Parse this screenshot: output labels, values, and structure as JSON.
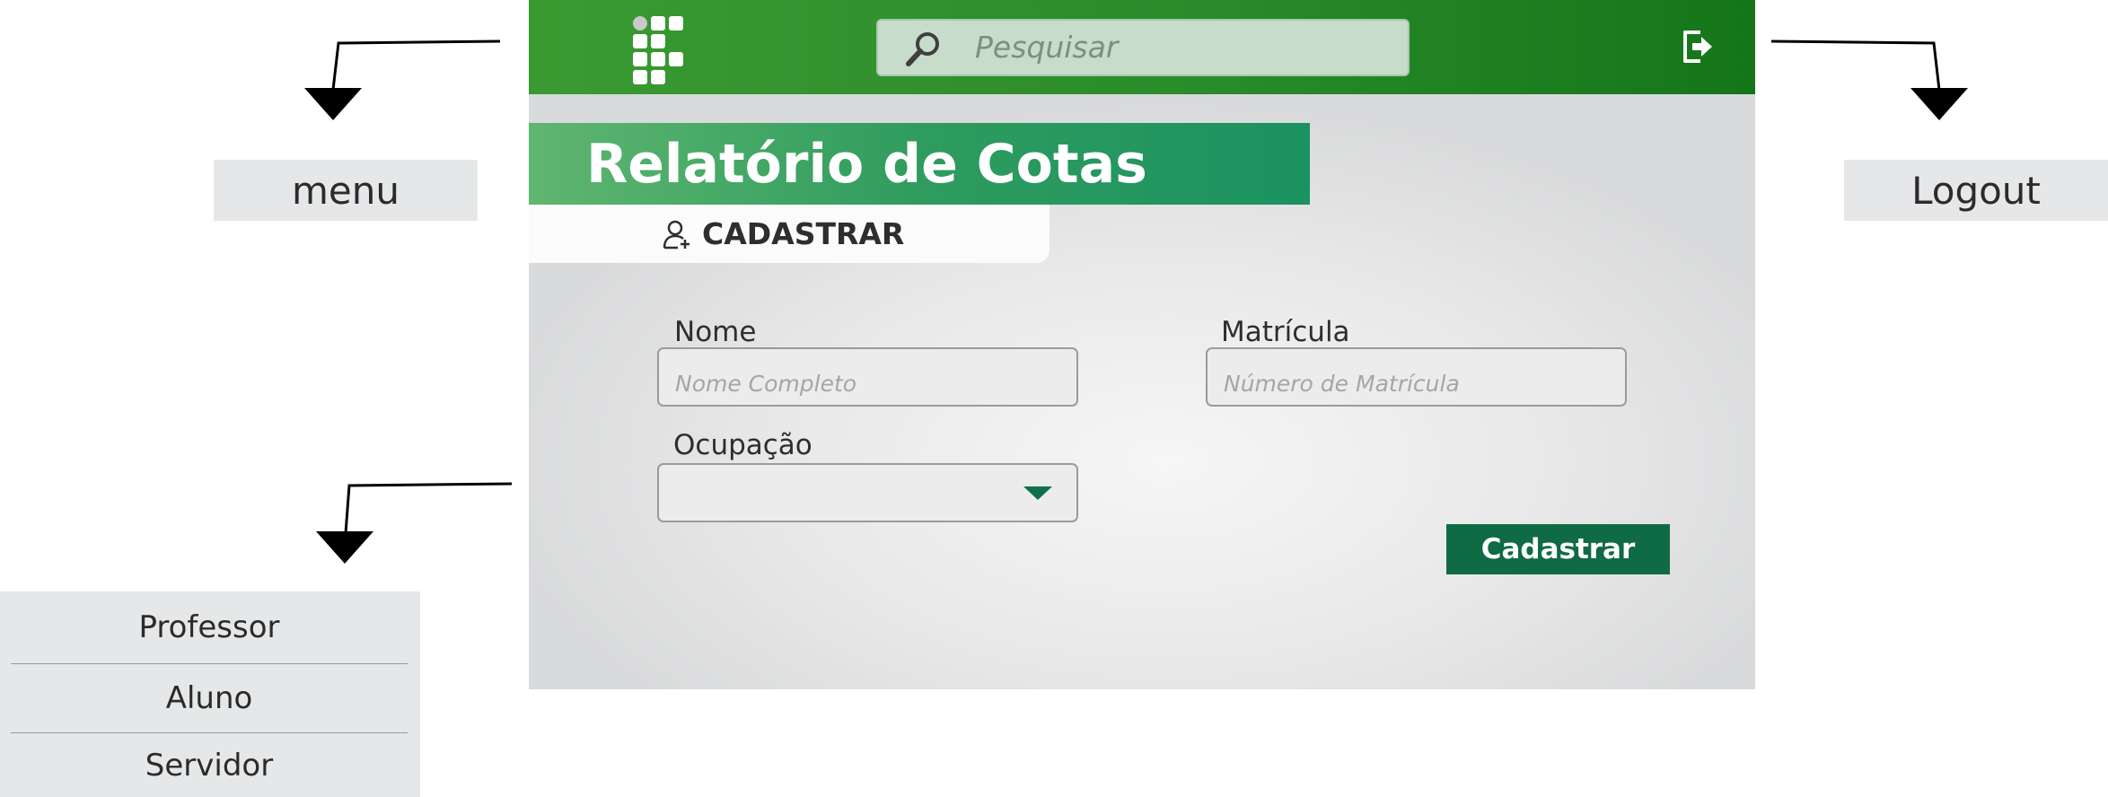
{
  "annotations": {
    "menu_label": "menu",
    "logout_label": "Logout",
    "occupation_options": [
      "Professor",
      "Aluno",
      "Servidor"
    ]
  },
  "header": {
    "search_placeholder": "Pesquisar"
  },
  "page": {
    "title": "Relatório de Cotas",
    "tab_label": "CADASTRAR"
  },
  "form": {
    "name_label": "Nome",
    "name_placeholder": "Nome Completo",
    "registration_label": "Matrícula",
    "registration_placeholder": "Número de Matrícula",
    "occupation_label": "Ocupação",
    "occupation_value": "",
    "submit_label": "Cadastrar"
  },
  "colors": {
    "header_green": "#2a8b2a",
    "accent_green": "#1b9261",
    "button_green": "#0f6b44"
  }
}
